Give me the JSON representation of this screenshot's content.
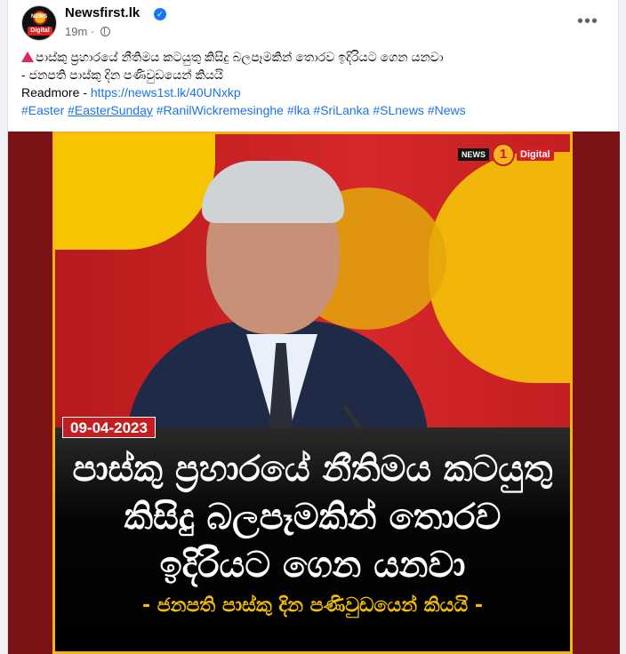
{
  "post": {
    "page_name": "Newsfirst.lk",
    "timestamp": "19m",
    "more_icon": "•••",
    "verified_icon": "✓",
    "avatar_top": "NEWS",
    "avatar_bottom": "Digital",
    "text_line1": "පාස්කු ප්‍රහාරයේ නීතිමය කටයුතු කිසිදු බලපෑමකින් තොරව ඉදිරියට ගෙන යනවා",
    "text_line2": "- ජනපති  පාස්කු දින පණිවුඩයෙන් කියයි",
    "readmore_label": "Readmore - ",
    "readmore_link": "https://news1st.lk/40UNxkp",
    "hashtags": [
      "#Easter",
      "#EasterSunday",
      "#RanilWickremesinghe",
      "#lka",
      "#SriLanka",
      "#SLnews",
      "#News"
    ]
  },
  "image": {
    "logo_news": "NEWS",
    "logo_one": "1",
    "logo_digital": "Digital",
    "date": "09-04-2023",
    "headline_line1": "පාස්කු ප්‍රහාරයේ නීතිමය කටයුතු",
    "headline_line2": "කිසිදු බලපෑමකින් තොරව",
    "headline_line3": "ඉදිරියට ගෙන යනවා",
    "subline": "- ජනපති පාස්කු දින පණිවුඩයෙන් කියයි -"
  },
  "colors": {
    "link": "#1b74e4",
    "brand_red": "#c31f22",
    "brand_yellow": "#f6c000"
  }
}
